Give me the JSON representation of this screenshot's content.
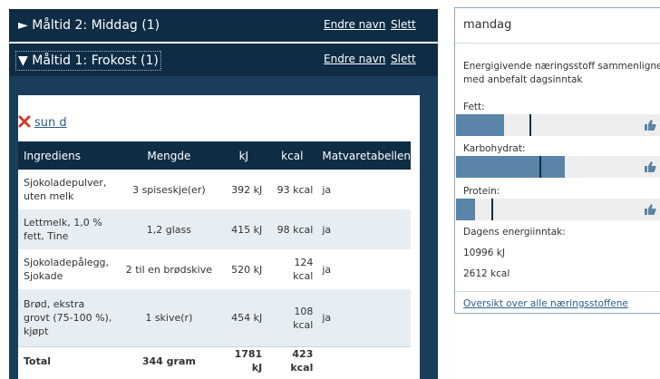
{
  "meals": [
    {
      "title": "Måltid 2: Middag (1)",
      "toggle": "►",
      "rename": "Endre navn",
      "delete": "Slett"
    },
    {
      "title": "Måltid 1: Frokost (1)",
      "toggle": "▼",
      "rename": "Endre navn",
      "delete": "Slett"
    }
  ],
  "recipe": {
    "name": "sun d",
    "remove_icon": "x-icon"
  },
  "table": {
    "headers": [
      "Ingrediens",
      "Mengde",
      "kJ",
      "kcal",
      "Matvaretabellen"
    ],
    "rows": [
      {
        "ingredient": "Sjokoladepulver, uten melk",
        "amount": "3 spiseskje(er)",
        "kj": "392 kJ",
        "kcal": "93 kcal",
        "table": "ja"
      },
      {
        "ingredient": "Lettmelk, 1,0 % fett, Tine",
        "amount": "1,2 glass",
        "kj": "415 kJ",
        "kcal": "98 kcal",
        "table": "ja"
      },
      {
        "ingredient": "Sjokoladepålegg, Sjokade",
        "amount": "2 til en brødskive",
        "kj": "520 kJ",
        "kcal": "124 kcal",
        "table": "ja"
      },
      {
        "ingredient": "Brød, ekstra grovt (75-100 %), kjøpt",
        "amount": "1 skive(r)",
        "kj": "454 kJ",
        "kcal": "108 kcal",
        "table": "ja"
      }
    ],
    "total": {
      "label": "Total",
      "amount": "344 gram",
      "kj": "1781 kJ",
      "kcal": "423 kcal"
    }
  },
  "panel": {
    "day": "mandag",
    "intro": "Energigivende næringsstoff sammenlignet med anbefalt dagsinntak",
    "nutrients": [
      {
        "label": "Fett:",
        "fill_fraction": 0.23,
        "marker_fraction": 0.35,
        "icon": "thumbs-up-icon"
      },
      {
        "label": "Karbohydrat:",
        "fill_fraction": 0.52,
        "marker_fraction": 0.4,
        "icon": "thumbs-up-icon"
      },
      {
        "label": "Protein:",
        "fill_fraction": 0.09,
        "marker_fraction": 0.17,
        "icon": "thumbs-up-icon"
      }
    ],
    "energy_label": "Dagens energiinntak:",
    "energy_kj": "10996 kJ",
    "energy_kcal": "2612 kcal",
    "overview_link": "Oversikt over alle næringsstoffene"
  },
  "colors": {
    "navy": "#0f2c45",
    "bar_fill": "#5a85a8",
    "row_alt": "#e7eef3",
    "link": "#2a5d8a",
    "delete_red": "#d33b2c"
  }
}
